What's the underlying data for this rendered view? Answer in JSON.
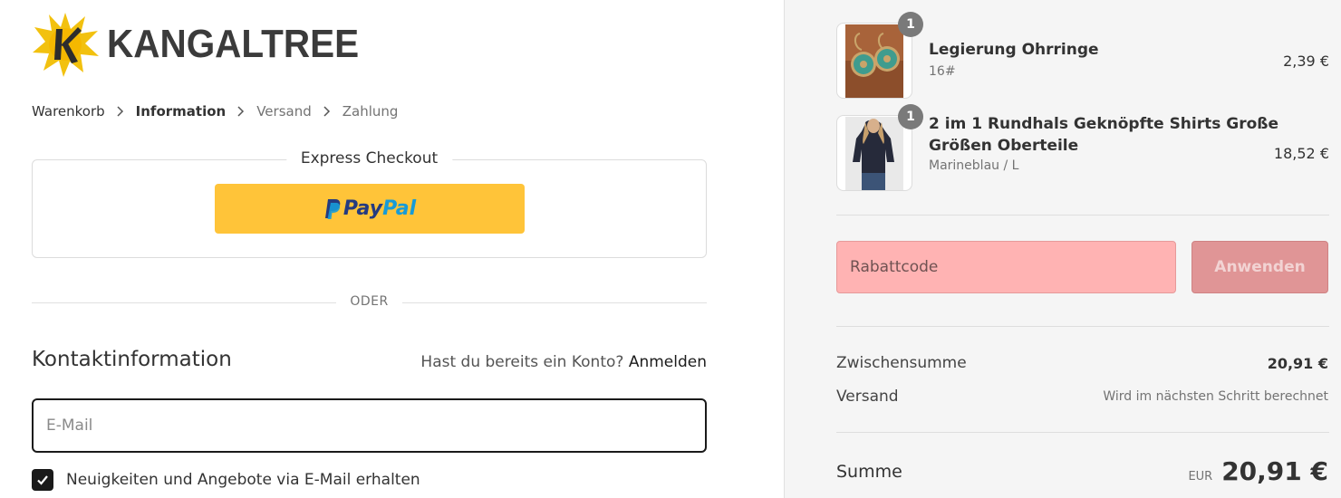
{
  "brand": {
    "name": "KANGALTREE"
  },
  "breadcrumb": {
    "items": [
      {
        "label": "Warenkorb"
      },
      {
        "label": "Information"
      },
      {
        "label": "Versand"
      },
      {
        "label": "Zahlung"
      }
    ]
  },
  "express": {
    "title": "Express Checkout",
    "paypal": {
      "pay": "Pay",
      "pal": "Pal",
      "color": "#ffc439"
    }
  },
  "divider": {
    "label": "ODER"
  },
  "contact": {
    "title": "Kontaktinformation",
    "login_prompt": "Hast du bereits ein Konto?",
    "login_link": "Anmelden",
    "email_placeholder": "E-Mail",
    "newsletter_label": "Neuigkeiten und Angebote via E-Mail erhalten",
    "newsletter_checked": true
  },
  "cart": {
    "items": [
      {
        "name": "Legierung Ohrringe",
        "variant": "16#",
        "price": "2,39 €",
        "quantity": "1"
      },
      {
        "name_line1": "2 im 1 Rundhals Geknöpfte Shirts Große",
        "name_line2": "Größen Oberteile",
        "variant": "Marineblau / L",
        "price": "18,52 €",
        "quantity": "1"
      }
    ]
  },
  "discount": {
    "placeholder": "Rabattcode",
    "apply_label": "Anwenden"
  },
  "summary": {
    "subtotal_label": "Zwischensumme",
    "subtotal_value": "20,91 €",
    "shipping_label": "Versand",
    "shipping_value": "Wird im nächsten Schritt berechnet",
    "total_label": "Summe",
    "currency": "EUR",
    "total_value": "20,91 €"
  }
}
